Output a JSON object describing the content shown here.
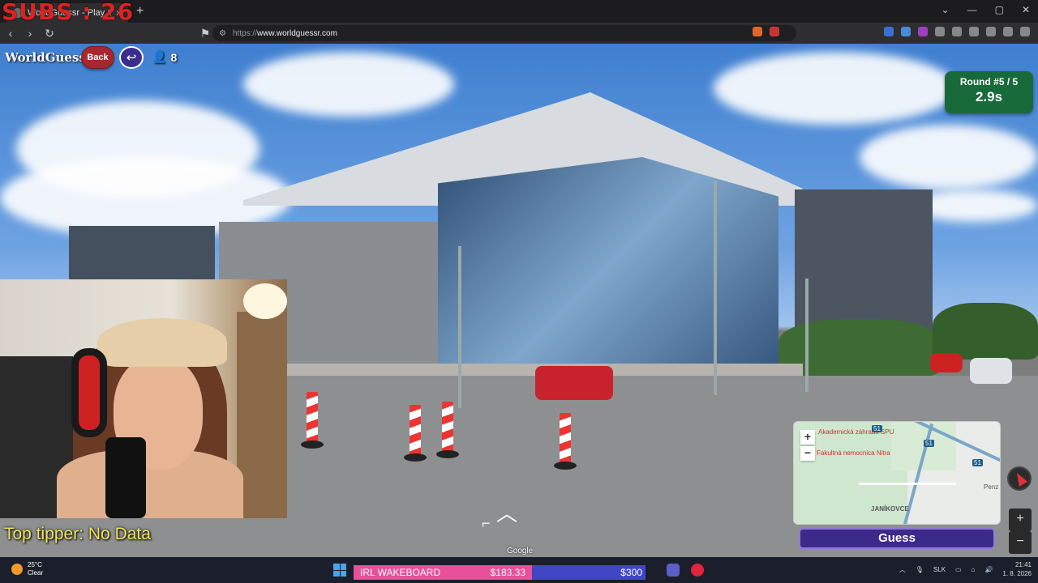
{
  "overlay": {
    "subs": "SUBS : 26",
    "top_tipper": "Top tipper: No Data"
  },
  "browser": {
    "tab_title": "WorldGuessr - Play Geogu",
    "url_prefix": "https://",
    "url_domain": "www.worldguessr.com"
  },
  "game": {
    "logo": "WorldGuessr",
    "back_label": "Back",
    "players_count": "8",
    "round_label": "Round #5 / 5",
    "timer": "2.9s",
    "guess_label": "Guess",
    "google_label": "Google",
    "zoom_in": "+",
    "zoom_out": "−"
  },
  "minimap": {
    "labels": [
      "Janíkovce",
      "Penz"
    ],
    "red_labels": [
      "Fakultná nemocnica Nitra",
      "Akademická záhrada SPU"
    ],
    "road_badges": [
      "51",
      "51",
      "51"
    ]
  },
  "taskbar": {
    "temp": "25°C",
    "weather": "Clear",
    "wake_label": "IRL WAKEBOARD",
    "wake_amount": "$183.33",
    "wake_goal": "$300",
    "lang": "SLK",
    "time": "21:41",
    "date": "1. 8. 2026"
  },
  "colors": {
    "round_bg": "#186a3b",
    "guess_bg": "#3b2a8a",
    "back_bg": "#a8272e",
    "subs": "#dd2222",
    "tipper": "#f3e65a"
  }
}
